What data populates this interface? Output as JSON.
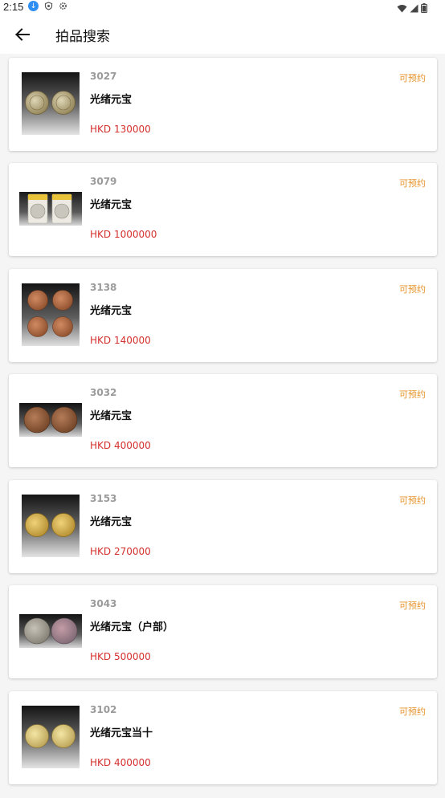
{
  "status_bar": {
    "time": "2:15"
  },
  "app_bar": {
    "title": "拍品搜索"
  },
  "colors": {
    "status_available": "#e6932a",
    "price": "#d4302e"
  },
  "lots": [
    {
      "lot_no": "3027",
      "title": "光绪元宝",
      "price": "HKD 130000",
      "status": "可预约",
      "thumb": "two-silver-coins"
    },
    {
      "lot_no": "3079",
      "title": "光绪元宝",
      "price": "HKD 1000000",
      "status": "可预约",
      "thumb": "two-graded-coins"
    },
    {
      "lot_no": "3138",
      "title": "光绪元宝",
      "price": "HKD 140000",
      "status": "可预约",
      "thumb": "four-copper-coins"
    },
    {
      "lot_no": "3032",
      "title": "光绪元宝",
      "price": "HKD 400000",
      "status": "可预约",
      "thumb": "two-copper-coins"
    },
    {
      "lot_no": "3153",
      "title": "光绪元宝",
      "price": "HKD 270000",
      "status": "可预约",
      "thumb": "two-gold-coins"
    },
    {
      "lot_no": "3043",
      "title": "光绪元宝（户部）",
      "price": "HKD 500000",
      "status": "可预约",
      "thumb": "two-toned-coins"
    },
    {
      "lot_no": "3102",
      "title": "光绪元宝当十",
      "price": "HKD 400000",
      "status": "可预约",
      "thumb": "two-brass-coins"
    }
  ]
}
